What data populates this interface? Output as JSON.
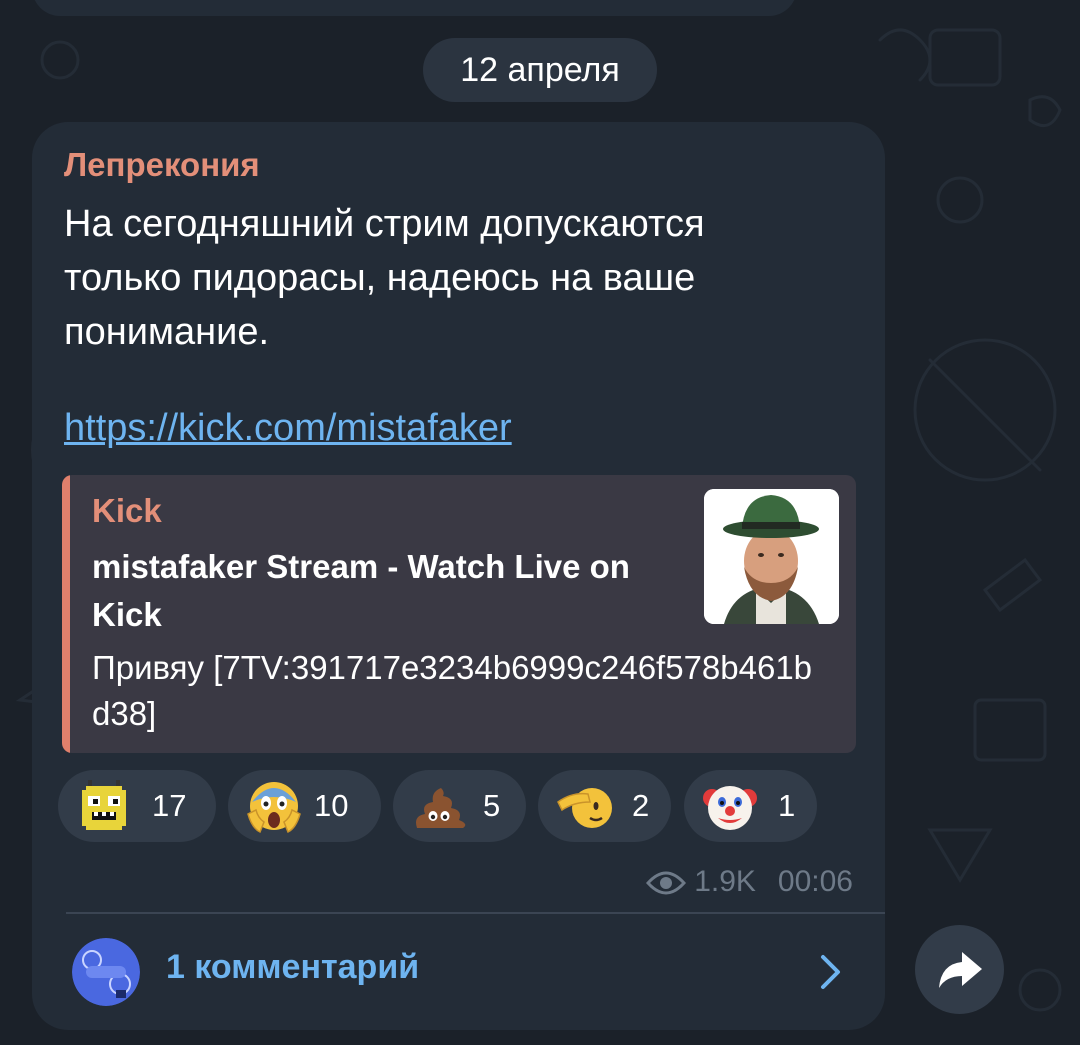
{
  "date_pill": "12 апреля",
  "message": {
    "author": "Лепрекония",
    "text": "На сегодняшний стрим допускаются\nтолько пидорасы, надеюсь на ваше\nпонимание.",
    "link": "https://kick.com/mistafaker",
    "preview": {
      "site": "Kick",
      "title": "mistafaker Stream - Watch Live on Kick",
      "description": "Привяу [7TV:391717e3234b6999c246f578b461bd38]"
    },
    "reactions": [
      {
        "emoji": "pixel-face-emoji",
        "count": "17"
      },
      {
        "emoji": "screaming-face-emoji",
        "count": "10"
      },
      {
        "emoji": "poop-emoji",
        "count": "5"
      },
      {
        "emoji": "saluting-face-emoji",
        "count": "2"
      },
      {
        "emoji": "clown-face-emoji",
        "count": "1"
      }
    ],
    "views": "1.9K",
    "time": "00:06",
    "comments_label": "1 комментарий"
  },
  "colors": {
    "background": "#1b2129",
    "bubble": "#232c37",
    "author": "#e38f79",
    "link": "#6eb4f0",
    "reaction_pill": "#323c49",
    "meta": "#6e7a88"
  }
}
